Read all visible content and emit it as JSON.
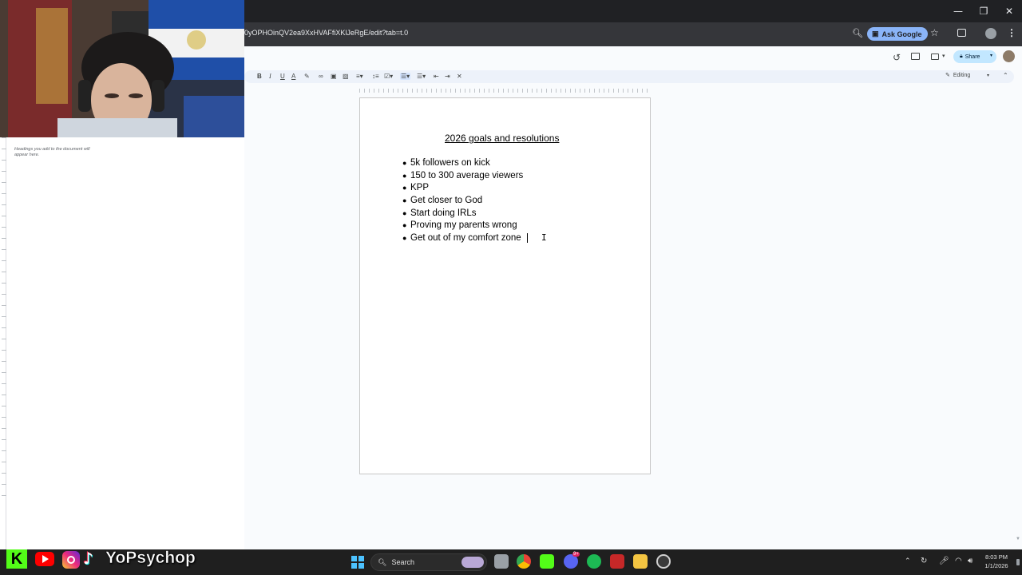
{
  "browser": {
    "url": "0yOPHOinQV2ea9XxHVAFfiXKlJeRgE/edit?tab=t.0",
    "ask_google_label": "Ask Google",
    "window_controls": [
      "—",
      "❐",
      "✕"
    ]
  },
  "docs": {
    "share_label": "Share",
    "mode_label": "Editing",
    "outline_hint": "Headings you add to the document will appear here.",
    "title": "2026 goals and resolutions",
    "goals": [
      "5k followers on kick",
      "150 to 300 average viewers",
      "KPP",
      "Get closer to God",
      "Start doing IRLs",
      "Proving my parents wrong",
      "Get out of my comfort zone"
    ],
    "toolbar_icons": [
      "bold-icon",
      "italic-icon",
      "underline-icon",
      "text-color-icon",
      "highlight-icon",
      "link-icon",
      "comment-add-icon",
      "image-icon",
      "align-icon",
      "line-spacing-icon",
      "checklist-icon",
      "bulleted-list-icon",
      "numbered-list-icon",
      "indent-decrease-icon",
      "indent-increase-icon",
      "clear-formatting-icon"
    ]
  },
  "overlay": {
    "channel_name": "YoPsychop",
    "kick_letter": "K",
    "tiktok_glyph": "♪"
  },
  "taskbar": {
    "search_label": "Search",
    "time": "8:03 PM",
    "date": "1/1/2026",
    "discord_badge": "9+",
    "apps": [
      "file-explorer-icon",
      "chrome-icon",
      "kick-app-icon",
      "discord-icon",
      "spotify-icon",
      "streaming-app-icon",
      "folder-icon",
      "obs-icon"
    ]
  },
  "colors": {
    "chrome_dark": "#202124",
    "ask_google_bg": "#8ab4f8",
    "share_bg": "#c2e7ff",
    "docs_bg": "#f9fbfd",
    "kick_green": "#53fc18",
    "taskbar_bg": "#1f1f1f"
  }
}
